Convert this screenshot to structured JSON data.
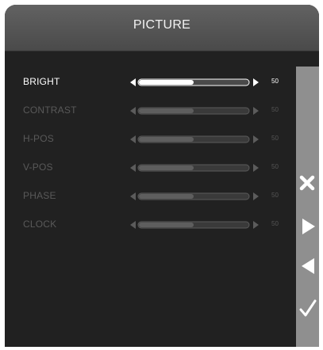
{
  "menu": {
    "title": "PICTURE",
    "items": [
      {
        "label": "BRIGHT",
        "value": "50",
        "level": 0.5,
        "active": true
      },
      {
        "label": "CONTRAST",
        "value": "50",
        "level": 0.5,
        "active": false
      },
      {
        "label": "H-POS",
        "value": "50",
        "level": 0.5,
        "active": false
      },
      {
        "label": "V-POS",
        "value": "50",
        "level": 0.5,
        "active": false
      },
      {
        "label": "PHASE",
        "value": "50",
        "level": 0.5,
        "active": false
      },
      {
        "label": "CLOCK",
        "value": "50",
        "level": 0.5,
        "active": false
      }
    ]
  },
  "side_buttons": [
    {
      "icon": "close-icon"
    },
    {
      "icon": "arrow-right-icon"
    },
    {
      "icon": "arrow-left-icon"
    },
    {
      "icon": "check-icon"
    }
  ],
  "colors": {
    "panel": "#212121",
    "header": "#555555",
    "sidebar": "#8f8f8f",
    "active_text": "#ffffff",
    "dim_text": "#595959"
  }
}
